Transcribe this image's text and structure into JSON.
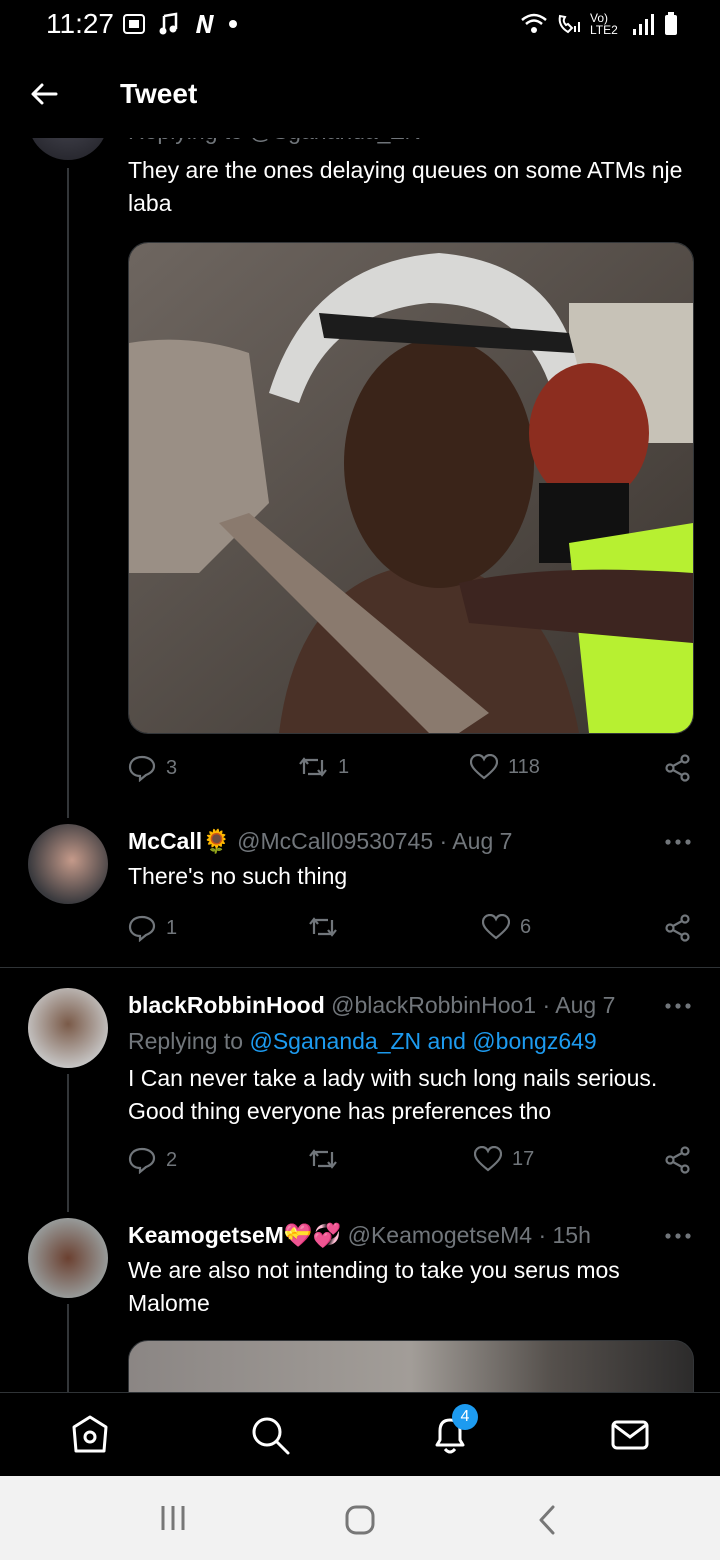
{
  "status_bar": {
    "time": "11:27",
    "network_label": "Vo) LTE2"
  },
  "header": {
    "title": "Tweet"
  },
  "main_tweet": {
    "replying_to": "Replying to @Sgananda_ZN",
    "text": "They are the ones delaying queues on some ATMs nje laba",
    "image_alt": "photo of a person in a helmet inside a car",
    "stats": {
      "replies": "3",
      "retweets": "1",
      "likes": "118"
    }
  },
  "replies": [
    {
      "name": "McCall🌻",
      "handle": "@McCall09530745",
      "time": "· Aug 7",
      "text": "There's no such thing",
      "stats": {
        "replies": "1",
        "retweets": "",
        "likes": "6"
      }
    },
    {
      "name": "blackRobbinHood",
      "handle": "@blackRobbinHoo1",
      "time": "· Aug 7",
      "replying_prefix": "Replying to",
      "replying_links": "@Sgananda_ZN and @bongz649",
      "text": "I Can never take a lady with such long nails serious. Good thing everyone has preferences tho",
      "stats": {
        "replies": "2",
        "retweets": "",
        "likes": "17"
      }
    },
    {
      "name": "KeamogetseM💝💞",
      "handle": "@KeamogetseM4",
      "time": "· 15h",
      "text": "We are also not intending to take you serus mos Malome"
    }
  ],
  "bottom_nav": {
    "notifications_badge": "4"
  },
  "colors": {
    "accent": "#1d9bf0",
    "background": "#000000",
    "secondary_text": "#71767b"
  }
}
